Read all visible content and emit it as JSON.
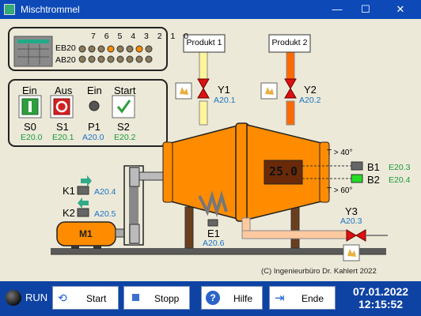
{
  "window": {
    "title": "Mischtrommel",
    "min": "—",
    "max": "☐",
    "close": "✕"
  },
  "plc": {
    "bit_header": "7 6 5 4 3 2 1 0",
    "row_eb": "EB20",
    "row_ab": "AB20"
  },
  "panel": {
    "s0": {
      "top": "Ein",
      "name": "S0",
      "addr": "E20.0"
    },
    "s1": {
      "top": "Aus",
      "name": "S1",
      "addr": "E20.1"
    },
    "p1": {
      "top": "Ein",
      "name": "P1",
      "addr": "A20.0"
    },
    "s2": {
      "top": "Start",
      "name": "S2",
      "addr": "E20.2"
    }
  },
  "produkt1": "Produkt 1",
  "produkt2": "Produkt 2",
  "y1": {
    "name": "Y1",
    "addr": "A20.1"
  },
  "y2": {
    "name": "Y2",
    "addr": "A20.2"
  },
  "y3": {
    "name": "Y3",
    "addr": "A20.3"
  },
  "k1": {
    "name": "K1",
    "addr": "A20.4"
  },
  "k2": {
    "name": "K2",
    "addr": "A20.5"
  },
  "e1": {
    "name": "E1",
    "addr": "A20.6"
  },
  "b1": {
    "name": "B1",
    "addr": "E20.3",
    "label": "T > 40°"
  },
  "b2": {
    "name": "B2",
    "addr": "E20.4",
    "label": "T > 60°"
  },
  "motor": "M1",
  "display_value": "25.0",
  "copyright": "(C) Ingenieurbüro Dr. Kahlert 2022",
  "bottom": {
    "run": "RUN",
    "start": "Start",
    "stopp": "Stopp",
    "hilfe": "Hilfe",
    "ende": "Ende",
    "date": "07.01.2022",
    "time": "12:15:52"
  },
  "colors": {
    "accent": "#0d4ab8",
    "drum": "#ff8c00",
    "led_on": "#ff8c00"
  }
}
